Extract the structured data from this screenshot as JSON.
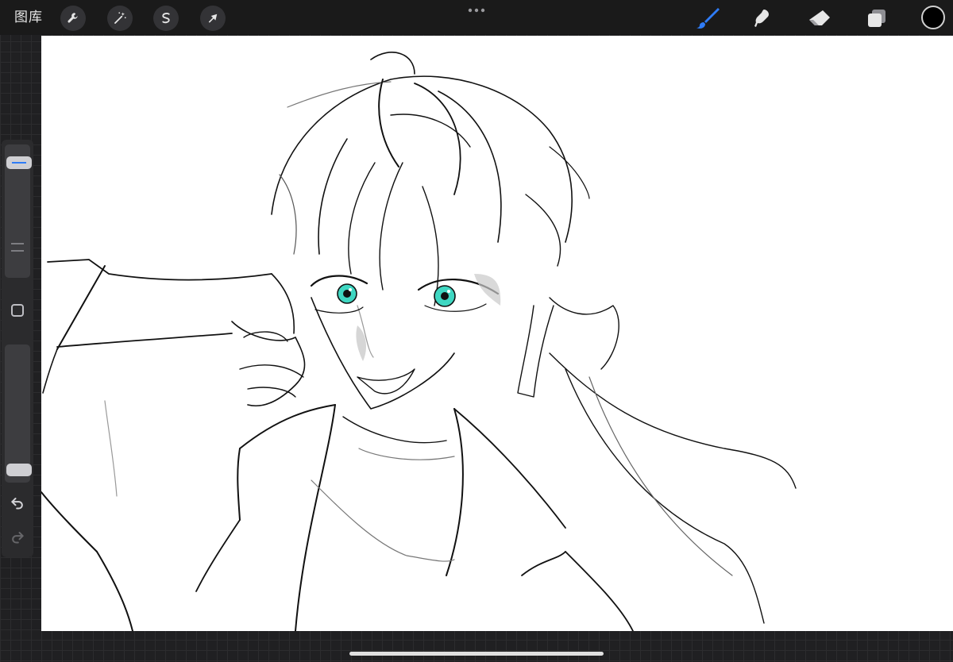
{
  "topbar": {
    "gallery_label": "图库",
    "left_tools": [
      "wrench-icon",
      "magic-wand-icon",
      "selection-icon",
      "transform-arrow-icon"
    ],
    "right_tools": [
      "brush-icon",
      "smudge-icon",
      "eraser-icon",
      "layers-icon"
    ],
    "active_tool": "brush-icon",
    "current_color": "#000000"
  },
  "sidebar": {
    "brush_size": 0.9,
    "brush_opacity": 0.05
  },
  "colors": {
    "accent": "#2f7cf6",
    "eye_color": "#3fd7c2"
  }
}
